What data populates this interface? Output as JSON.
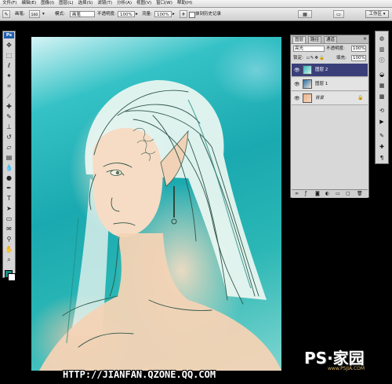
{
  "menubar": {
    "items": [
      "文件(F)",
      "编辑(E)",
      "图像(I)",
      "图层(L)",
      "选择(S)",
      "滤镜(T)",
      "分析(A)",
      "视图(V)",
      "窗口(W)",
      "帮助(H)"
    ]
  },
  "options": {
    "brush_label": "画笔:",
    "brush_size": "500",
    "mode_label": "模式:",
    "mode_value": "画笔",
    "opacity_label": "不透明度:",
    "opacity_value": "100%",
    "flow_label": "流量:",
    "flow_value": "100%",
    "history_label": "抹到历史记录",
    "workspace_label": "工作区 ▾"
  },
  "toolbox": {
    "badge": "Ps",
    "foreground_color": "#1a8c86",
    "background_color": "#ffffff"
  },
  "layers_panel": {
    "tabs": [
      "图层",
      "路径",
      "通道"
    ],
    "close_glyph": "×",
    "blend_mode": "亮光",
    "opacity_label": "不透明度:",
    "opacity_value": "100%",
    "lock_label": "锁定:",
    "fill_label": "填充:",
    "fill_value": "100%",
    "layers": [
      {
        "name": "图层 2",
        "selected": true
      },
      {
        "name": "图层 1",
        "selected": false
      },
      {
        "name": "背景",
        "selected": false,
        "locked": true
      }
    ],
    "footer_icons": [
      "link-icon",
      "fx-icon",
      "mask-icon",
      "adjustment-icon",
      "group-icon",
      "new-layer-icon",
      "trash-icon"
    ]
  },
  "watermark": {
    "url": "HTTP://JIANFAN.QZONE.QQ.COM",
    "logo": "PS·家园",
    "site": "www.PSJIA.COM"
  }
}
